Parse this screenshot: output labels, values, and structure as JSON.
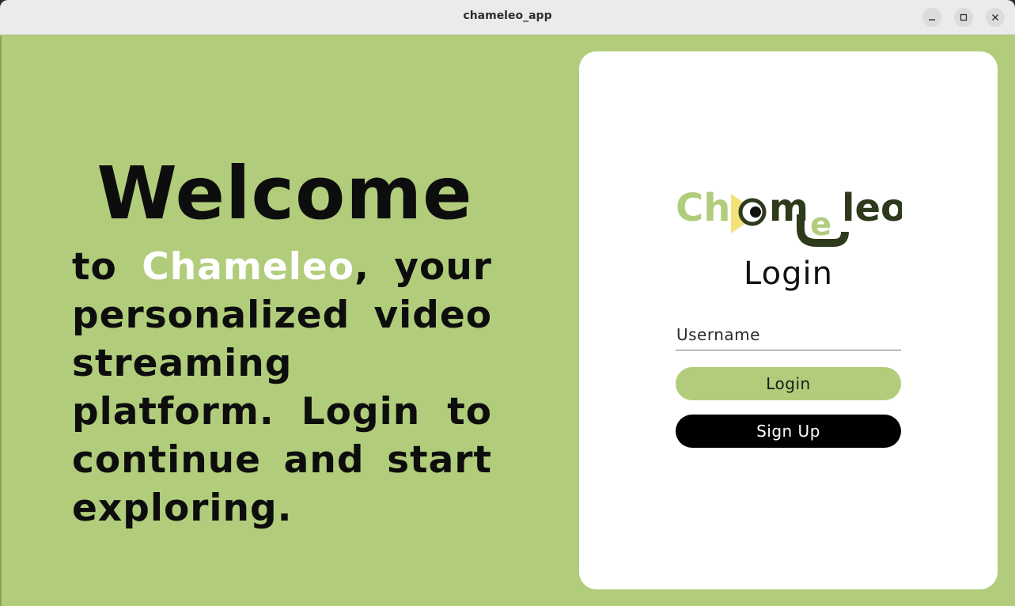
{
  "window": {
    "title": "chameleo_app",
    "controls": {
      "minimize": "minimize-icon",
      "maximize": "maximize-icon",
      "close": "close-icon"
    }
  },
  "welcome": {
    "title": "Welcome",
    "body_before": "to ",
    "brand": "Chameleo",
    "body_after": ", your personalized video streaming platform. Login to continue and start exploring."
  },
  "login_card": {
    "logo_text": "Chameleo",
    "heading": "Login",
    "username_placeholder": "Username",
    "login_button": "Login",
    "signup_button": "Sign Up"
  },
  "colors": {
    "background_green": "#b1cd7b",
    "logo_dark": "#2e3a1c",
    "logo_light": "#b1cd7b",
    "play_yellow": "#f3e27a",
    "button_dark": "#000000"
  }
}
